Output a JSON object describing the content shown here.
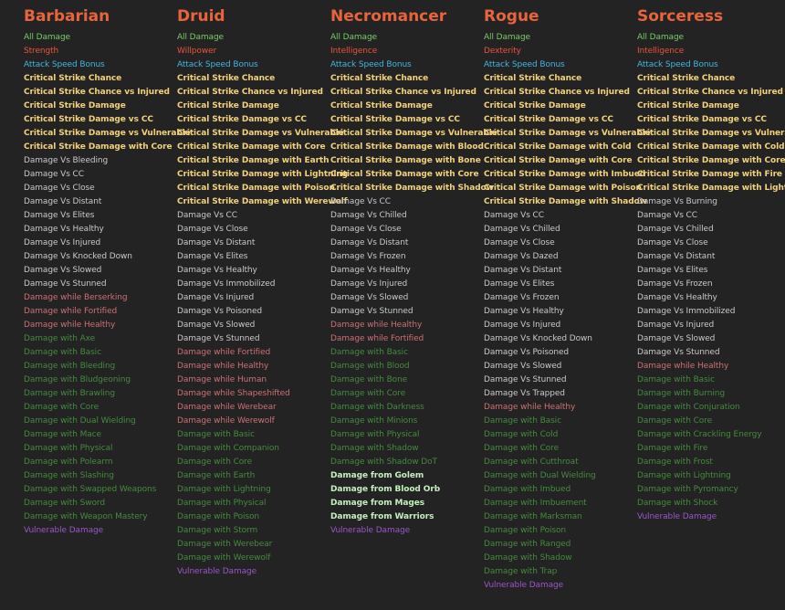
{
  "colors": {
    "heading": "#e8643c",
    "all_damage": "#7cc96a",
    "stat": "#e8543c",
    "attack_speed": "#45b4dc",
    "critical": "#f1d27a",
    "damage_vs": "#c9c9c9",
    "damage_while": "#cc6f74",
    "damage_with": "#458a3e",
    "damage_from": "#c6efc0",
    "vulnerable": "#9a55c8",
    "background": "#232323"
  },
  "columns": [
    {
      "title": "Barbarian",
      "items": [
        {
          "text": "All Damage",
          "color": "green"
        },
        {
          "text": "Strength",
          "color": "red"
        },
        {
          "text": "Attack Speed Bonus",
          "color": "blue"
        },
        {
          "text": "Critical Strike Chance",
          "color": "yellow"
        },
        {
          "text": "Critical Strike Chance vs Injured",
          "color": "yellow"
        },
        {
          "text": "Critical Strike Damage",
          "color": "yellow"
        },
        {
          "text": "Critical Strike Damage vs CC",
          "color": "yellow"
        },
        {
          "text": "Critical Strike Damage vs Vulnerable",
          "color": "yellow"
        },
        {
          "text": "Critical Strike Damage with Core",
          "color": "yellow"
        },
        {
          "text": "Damage Vs Bleeding",
          "color": "white"
        },
        {
          "text": "Damage Vs CC",
          "color": "white"
        },
        {
          "text": "Damage Vs Close",
          "color": "white"
        },
        {
          "text": "Damage Vs Distant",
          "color": "white"
        },
        {
          "text": "Damage Vs Elites",
          "color": "white"
        },
        {
          "text": "Damage Vs Healthy",
          "color": "white"
        },
        {
          "text": "Damage Vs Injured",
          "color": "white"
        },
        {
          "text": "Damage Vs Knocked Down",
          "color": "white"
        },
        {
          "text": "Damage Vs Slowed",
          "color": "white"
        },
        {
          "text": "Damage Vs Stunned",
          "color": "white"
        },
        {
          "text": "Damage while Berserking",
          "color": "pink"
        },
        {
          "text": "Damage while Fortified",
          "color": "pink"
        },
        {
          "text": "Damage while Healthy",
          "color": "pink"
        },
        {
          "text": "Damage with Axe",
          "color": "dgreen"
        },
        {
          "text": "Damage with Basic",
          "color": "dgreen"
        },
        {
          "text": "Damage with Bleeding",
          "color": "dgreen"
        },
        {
          "text": "Damage with Bludgeoning",
          "color": "dgreen"
        },
        {
          "text": "Damage with Brawling",
          "color": "dgreen"
        },
        {
          "text": "Damage with Core",
          "color": "dgreen"
        },
        {
          "text": "Damage with Dual Wielding",
          "color": "dgreen"
        },
        {
          "text": "Damage with Mace",
          "color": "dgreen"
        },
        {
          "text": "Damage with Physical",
          "color": "dgreen"
        },
        {
          "text": "Damage with Polearm",
          "color": "dgreen"
        },
        {
          "text": "Damage with Slashing",
          "color": "dgreen"
        },
        {
          "text": "Damage with Swapped Weapons",
          "color": "dgreen"
        },
        {
          "text": "Damage with Sword",
          "color": "dgreen"
        },
        {
          "text": "Damage with Weapon Mastery",
          "color": "dgreen"
        },
        {
          "text": "Vulnerable Damage",
          "color": "purple"
        }
      ]
    },
    {
      "title": "Druid",
      "items": [
        {
          "text": "All Damage",
          "color": "green"
        },
        {
          "text": "Willpower",
          "color": "red"
        },
        {
          "text": "Attack Speed Bonus",
          "color": "blue"
        },
        {
          "text": "Critical Strike Chance",
          "color": "yellow"
        },
        {
          "text": "Critical Strike Chance vs Injured",
          "color": "yellow"
        },
        {
          "text": "Critical Strike Damage",
          "color": "yellow"
        },
        {
          "text": "Critical Strike Damage vs CC",
          "color": "yellow"
        },
        {
          "text": "Critical Strike Damage vs Vulnerable",
          "color": "yellow"
        },
        {
          "text": "Critical Strike Damage with Core",
          "color": "yellow"
        },
        {
          "text": "Critical Strike Damage with Earth",
          "color": "yellow"
        },
        {
          "text": "Critical Strike Damage with Lightning",
          "color": "yellow"
        },
        {
          "text": "Critical Strike Damage with Poison",
          "color": "yellow"
        },
        {
          "text": "Critical Strike Damage with Werewolf",
          "color": "yellow"
        },
        {
          "text": "Damage Vs CC",
          "color": "white"
        },
        {
          "text": "Damage Vs Close",
          "color": "white"
        },
        {
          "text": "Damage Vs Distant",
          "color": "white"
        },
        {
          "text": "Damage Vs Elites",
          "color": "white"
        },
        {
          "text": "Damage Vs Healthy",
          "color": "white"
        },
        {
          "text": "Damage Vs Immobilized",
          "color": "white"
        },
        {
          "text": "Damage Vs Injured",
          "color": "white"
        },
        {
          "text": "Damage Vs Poisoned",
          "color": "white"
        },
        {
          "text": "Damage Vs Slowed",
          "color": "white"
        },
        {
          "text": "Damage Vs Stunned",
          "color": "white"
        },
        {
          "text": "Damage while Fortified",
          "color": "pink"
        },
        {
          "text": "Damage while Healthy",
          "color": "pink"
        },
        {
          "text": "Damage while Human",
          "color": "pink"
        },
        {
          "text": "Damage while Shapeshifted",
          "color": "pink"
        },
        {
          "text": "Damage while Werebear",
          "color": "pink"
        },
        {
          "text": "Damage while Werewolf",
          "color": "pink"
        },
        {
          "text": "Damage with Basic",
          "color": "dgreen"
        },
        {
          "text": "Damage with Companion",
          "color": "dgreen"
        },
        {
          "text": "Damage with Core",
          "color": "dgreen"
        },
        {
          "text": "Damage with Earth",
          "color": "dgreen"
        },
        {
          "text": "Damage with Lightning",
          "color": "dgreen"
        },
        {
          "text": "Damage with Physical",
          "color": "dgreen"
        },
        {
          "text": "Damage with Poison",
          "color": "dgreen"
        },
        {
          "text": "Damage with Storm",
          "color": "dgreen"
        },
        {
          "text": "Damage with Werebear",
          "color": "dgreen"
        },
        {
          "text": "Damage with Werewolf",
          "color": "dgreen"
        },
        {
          "text": "Vulnerable Damage",
          "color": "purple"
        }
      ]
    },
    {
      "title": "Necromancer",
      "items": [
        {
          "text": "All Damage",
          "color": "green"
        },
        {
          "text": "Intelligence",
          "color": "red"
        },
        {
          "text": "Attack Speed Bonus",
          "color": "blue"
        },
        {
          "text": "Critical Strike Chance",
          "color": "yellow"
        },
        {
          "text": "Critical Strike Chance vs Injured",
          "color": "yellow"
        },
        {
          "text": "Critical Strike Damage",
          "color": "yellow"
        },
        {
          "text": "Critical Strike Damage vs CC",
          "color": "yellow"
        },
        {
          "text": "Critical Strike Damage vs Vulnerable",
          "color": "yellow"
        },
        {
          "text": "Critical Strike Damage with Blood",
          "color": "yellow"
        },
        {
          "text": "Critical Strike Damage with Bone",
          "color": "yellow"
        },
        {
          "text": "Critical Strike Damage with Core",
          "color": "yellow"
        },
        {
          "text": "Critical Strike Damage with Shadow",
          "color": "yellow"
        },
        {
          "text": "Damage Vs CC",
          "color": "white"
        },
        {
          "text": "Damage Vs Chilled",
          "color": "white"
        },
        {
          "text": "Damage Vs Close",
          "color": "white"
        },
        {
          "text": "Damage Vs Distant",
          "color": "white"
        },
        {
          "text": "Damage Vs Frozen",
          "color": "white"
        },
        {
          "text": "Damage Vs Healthy",
          "color": "white"
        },
        {
          "text": "Damage Vs Injured",
          "color": "white"
        },
        {
          "text": "Damage Vs Slowed",
          "color": "white"
        },
        {
          "text": "Damage Vs Stunned",
          "color": "white"
        },
        {
          "text": "Damage while Healthy",
          "color": "pink"
        },
        {
          "text": "Damage while Fortified",
          "color": "pink"
        },
        {
          "text": "Damage with Basic",
          "color": "dgreen"
        },
        {
          "text": "Damage with Blood",
          "color": "dgreen"
        },
        {
          "text": "Damage with Bone",
          "color": "dgreen"
        },
        {
          "text": "Damage with Core",
          "color": "dgreen"
        },
        {
          "text": "Damage with Darkness",
          "color": "dgreen"
        },
        {
          "text": "Damage with Minions",
          "color": "dgreen"
        },
        {
          "text": "Damage with Physical",
          "color": "dgreen"
        },
        {
          "text": "Damage with Shadow",
          "color": "dgreen"
        },
        {
          "text": "Damage with Shadow DoT",
          "color": "dgreen"
        },
        {
          "text": "Damage from Golem",
          "color": "mint"
        },
        {
          "text": "Damage from Blood Orb",
          "color": "mint"
        },
        {
          "text": "Damage from Mages",
          "color": "mint"
        },
        {
          "text": "Damage from Warriors",
          "color": "mint"
        },
        {
          "text": "Vulnerable Damage",
          "color": "purple"
        }
      ]
    },
    {
      "title": "Rogue",
      "items": [
        {
          "text": "All Damage",
          "color": "green"
        },
        {
          "text": "Dexterity",
          "color": "red"
        },
        {
          "text": "Attack Speed Bonus",
          "color": "blue"
        },
        {
          "text": "Critical Strike Chance",
          "color": "yellow"
        },
        {
          "text": "Critical Strike Chance vs Injured",
          "color": "yellow"
        },
        {
          "text": "Critical Strike Damage",
          "color": "yellow"
        },
        {
          "text": "Critical Strike Damage vs CC",
          "color": "yellow"
        },
        {
          "text": "Critical Strike Damage vs Vulnerable",
          "color": "yellow"
        },
        {
          "text": "Critical Strike Damage with Cold",
          "color": "yellow"
        },
        {
          "text": "Critical Strike Damage with Core",
          "color": "yellow"
        },
        {
          "text": "Critical Strike Damage with Imbued",
          "color": "yellow"
        },
        {
          "text": "Critical Strike Damage with Poison",
          "color": "yellow"
        },
        {
          "text": "Critical Strike Damage with Shadow",
          "color": "yellow"
        },
        {
          "text": "Damage Vs CC",
          "color": "white"
        },
        {
          "text": "Damage Vs Chilled",
          "color": "white"
        },
        {
          "text": "Damage Vs Close",
          "color": "white"
        },
        {
          "text": "Damage Vs Dazed",
          "color": "white"
        },
        {
          "text": "Damage Vs Distant",
          "color": "white"
        },
        {
          "text": "Damage Vs Elites",
          "color": "white"
        },
        {
          "text": "Damage Vs Frozen",
          "color": "white"
        },
        {
          "text": "Damage Vs Healthy",
          "color": "white"
        },
        {
          "text": "Damage Vs Injured",
          "color": "white"
        },
        {
          "text": "Damage Vs Knocked Down",
          "color": "white"
        },
        {
          "text": "Damage Vs Poisoned",
          "color": "white"
        },
        {
          "text": "Damage Vs Slowed",
          "color": "white"
        },
        {
          "text": "Damage Vs Stunned",
          "color": "white"
        },
        {
          "text": "Damage Vs Trapped",
          "color": "white"
        },
        {
          "text": "Damage while Healthy",
          "color": "pink"
        },
        {
          "text": "Damage with Basic",
          "color": "dgreen"
        },
        {
          "text": "Damage with Cold",
          "color": "dgreen"
        },
        {
          "text": "Damage with Core",
          "color": "dgreen"
        },
        {
          "text": "Damage with Cutthroat",
          "color": "dgreen"
        },
        {
          "text": "Damage with Dual Wielding",
          "color": "dgreen"
        },
        {
          "text": "Damage with Imbued",
          "color": "dgreen"
        },
        {
          "text": "Damage with Imbuement",
          "color": "dgreen"
        },
        {
          "text": "Damage with Marksman",
          "color": "dgreen"
        },
        {
          "text": "Damage with Poison",
          "color": "dgreen"
        },
        {
          "text": "Damage with Ranged",
          "color": "dgreen"
        },
        {
          "text": "Damage with Shadow",
          "color": "dgreen"
        },
        {
          "text": "Damage with Trap",
          "color": "dgreen"
        },
        {
          "text": "Vulnerable Damage",
          "color": "purple"
        }
      ]
    },
    {
      "title": "Sorceress",
      "items": [
        {
          "text": "All Damage",
          "color": "green"
        },
        {
          "text": "Intelligence",
          "color": "red"
        },
        {
          "text": "Attack Speed Bonus",
          "color": "blue"
        },
        {
          "text": "Critical Strike Chance",
          "color": "yellow"
        },
        {
          "text": "Critical Strike Chance vs Injured",
          "color": "yellow"
        },
        {
          "text": "Critical Strike Damage",
          "color": "yellow"
        },
        {
          "text": "Critical Strike Damage vs CC",
          "color": "yellow"
        },
        {
          "text": "Critical Strike Damage vs Vulnerable",
          "color": "yellow"
        },
        {
          "text": "Critical Strike Damage with Cold",
          "color": "yellow"
        },
        {
          "text": "Critical Strike Damage with Core",
          "color": "yellow"
        },
        {
          "text": "Critical Strike Damage with Fire",
          "color": "yellow"
        },
        {
          "text": "Critical Strike Damage with Lightning",
          "color": "yellow"
        },
        {
          "text": "Damage Vs Burning",
          "color": "white"
        },
        {
          "text": "Damage Vs CC",
          "color": "white"
        },
        {
          "text": "Damage Vs Chilled",
          "color": "white"
        },
        {
          "text": "Damage Vs Close",
          "color": "white"
        },
        {
          "text": "Damage Vs Distant",
          "color": "white"
        },
        {
          "text": "Damage Vs Elites",
          "color": "white"
        },
        {
          "text": "Damage Vs Frozen",
          "color": "white"
        },
        {
          "text": "Damage Vs Healthy",
          "color": "white"
        },
        {
          "text": "Damage Vs Immobilized",
          "color": "white"
        },
        {
          "text": "Damage Vs Injured",
          "color": "white"
        },
        {
          "text": "Damage Vs Slowed",
          "color": "white"
        },
        {
          "text": "Damage Vs Stunned",
          "color": "white"
        },
        {
          "text": "Damage while Healthy",
          "color": "pink"
        },
        {
          "text": "Damage with Basic",
          "color": "dgreen"
        },
        {
          "text": "Damage with Burning",
          "color": "dgreen"
        },
        {
          "text": "Damage with Conjuration",
          "color": "dgreen"
        },
        {
          "text": "Damage with Core",
          "color": "dgreen"
        },
        {
          "text": "Damage with Crackling Energy",
          "color": "dgreen"
        },
        {
          "text": "Damage with Fire",
          "color": "dgreen"
        },
        {
          "text": "Damage with Frost",
          "color": "dgreen"
        },
        {
          "text": "Damage with Lightning",
          "color": "dgreen"
        },
        {
          "text": "Damage with Pyromancy",
          "color": "dgreen"
        },
        {
          "text": "Damage with Shock",
          "color": "dgreen"
        },
        {
          "text": "Vulnerable Damage",
          "color": "purple"
        }
      ]
    }
  ]
}
